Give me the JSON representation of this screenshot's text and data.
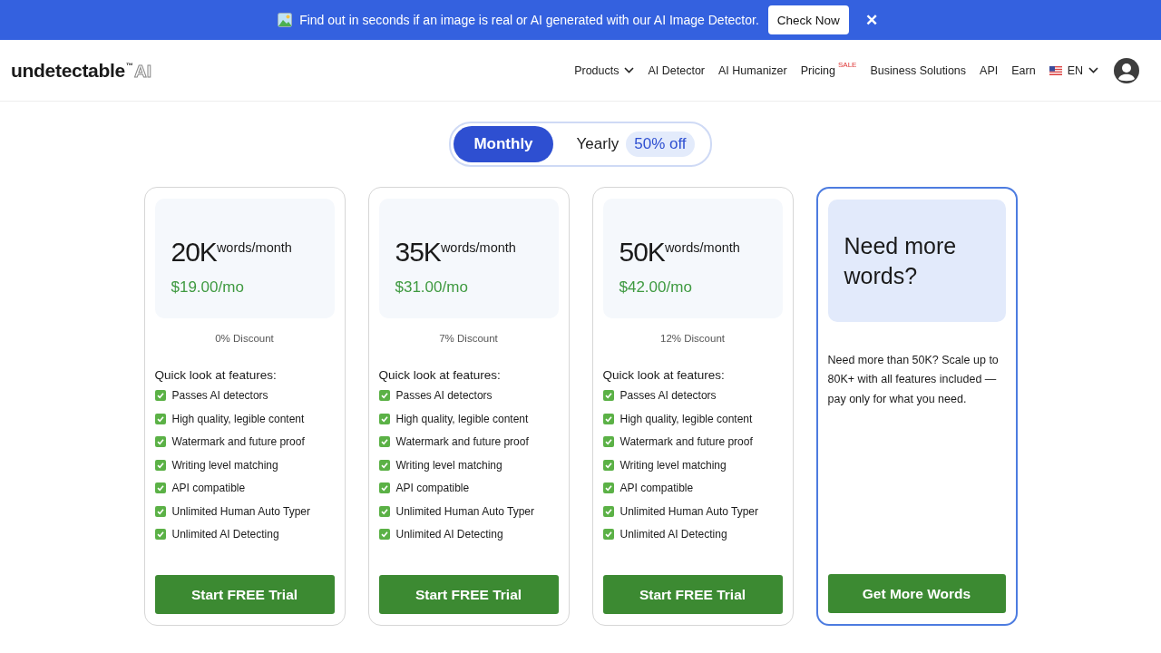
{
  "banner": {
    "text": "Find out in seconds if an image is real or AI generated with our AI Image Detector.",
    "button": "Check Now",
    "close": "✕"
  },
  "header": {
    "logo": {
      "word": "undetectable",
      "mark": "™",
      "suffix": "AI"
    },
    "nav": [
      {
        "label": "Products",
        "dropdown": true
      },
      {
        "label": "AI Detector",
        "dropdown": false
      },
      {
        "label": "AI Humanizer",
        "dropdown": false
      },
      {
        "label": "Pricing",
        "dropdown": false,
        "badge": "SALE"
      },
      {
        "label": "Business Solutions",
        "dropdown": false
      },
      {
        "label": "API",
        "dropdown": false
      },
      {
        "label": "Earn",
        "dropdown": false
      }
    ],
    "language": "EN"
  },
  "billing_toggle": [
    {
      "label": "Monthly",
      "selected": true
    },
    {
      "label": "Yearly",
      "selected": false,
      "badge": "50% off"
    }
  ],
  "plans": [
    {
      "kind": "plan",
      "amount": "20K",
      "unit": "words/month",
      "price": "$19.00/mo",
      "discount": "0% Discount",
      "features_title": "Quick look at features:",
      "features": [
        "Passes AI detectors",
        "High quality, legible content",
        "Watermark and future proof",
        "Writing level matching",
        "API compatible",
        "Unlimited Human Auto Typer",
        "Unlimited AI Detecting"
      ],
      "button": "Start FREE Trial"
    },
    {
      "kind": "plan",
      "amount": "35K",
      "unit": "words/month",
      "price": "$31.00/mo",
      "discount": "7% Discount",
      "features_title": "Quick look at features:",
      "features": [
        "Passes AI detectors",
        "High quality, legible content",
        "Watermark and future proof",
        "Writing level matching",
        "API compatible",
        "Unlimited Human Auto Typer",
        "Unlimited AI Detecting"
      ],
      "button": "Start FREE Trial"
    },
    {
      "kind": "plan",
      "amount": "50K",
      "unit": "words/month",
      "price": "$42.00/mo",
      "discount": "12% Discount",
      "features_title": "Quick look at features:",
      "features": [
        "Passes AI detectors",
        "High quality, legible content",
        "Watermark and future proof",
        "Writing level matching",
        "API compatible",
        "Unlimited Human Auto Typer",
        "Unlimited AI Detecting"
      ],
      "button": "Start FREE Trial"
    },
    {
      "kind": "custom",
      "title": "Need more words?",
      "description": "Need more than 50K? Scale up to 80K+ with all features included — pay only for what you need.",
      "button": "Get More Words"
    }
  ]
}
